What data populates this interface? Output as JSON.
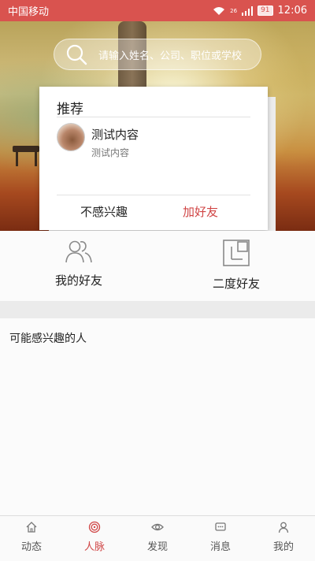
{
  "status_bar": {
    "carrier": "中国移动",
    "network": "26",
    "battery": "91",
    "time": "12:06"
  },
  "search": {
    "placeholder": "请输入姓名、公司、职位或学校"
  },
  "recommend_card": {
    "title": "推荐",
    "person_name": "测试内容",
    "person_subtitle": "测试内容",
    "dismiss_label": "不感兴趣",
    "add_friend_label": "加好友"
  },
  "friends_section": {
    "my_friends_label": "我的好友",
    "second_degree_label": "二度好友"
  },
  "interest_section": {
    "title": "可能感兴趣的人"
  },
  "tabbar": {
    "items": [
      {
        "label": "动态",
        "icon": "home-icon"
      },
      {
        "label": "人脉",
        "icon": "connections-icon"
      },
      {
        "label": "发现",
        "icon": "eye-icon"
      },
      {
        "label": "消息",
        "icon": "message-icon"
      },
      {
        "label": "我的",
        "icon": "person-icon"
      }
    ],
    "active": "人脉"
  },
  "colors": {
    "accent": "#d04545",
    "status_bar": "#d9534f"
  }
}
